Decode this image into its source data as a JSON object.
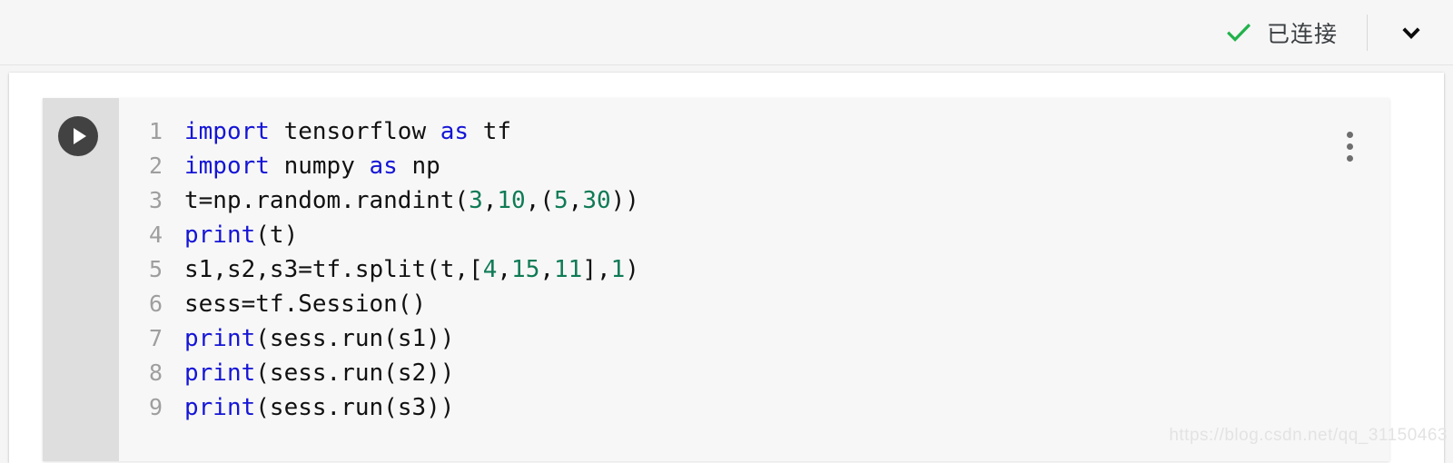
{
  "header": {
    "status_label": "已连接",
    "status_icon": "check-icon",
    "status_color": "#22b24c",
    "expand_icon": "chevron-down-icon"
  },
  "cell": {
    "run_icon": "play-icon",
    "menu_icon": "more-vert-icon",
    "language": "python",
    "line_count": 9,
    "lines": [
      {
        "number": "1",
        "tokens": [
          {
            "t": "import",
            "c": "kw"
          },
          {
            "t": " tensorflow ",
            "c": "pl"
          },
          {
            "t": "as",
            "c": "kw"
          },
          {
            "t": " tf",
            "c": "pl"
          }
        ],
        "text": "import tensorflow as tf"
      },
      {
        "number": "2",
        "tokens": [
          {
            "t": "import",
            "c": "kw"
          },
          {
            "t": " numpy ",
            "c": "pl"
          },
          {
            "t": "as",
            "c": "kw"
          },
          {
            "t": " np",
            "c": "pl"
          }
        ],
        "text": "import numpy as np"
      },
      {
        "number": "3",
        "tokens": [
          {
            "t": "t=np.random.randint(",
            "c": "pl"
          },
          {
            "t": "3",
            "c": "num"
          },
          {
            "t": ",",
            "c": "pl"
          },
          {
            "t": "10",
            "c": "num"
          },
          {
            "t": ",(",
            "c": "pl"
          },
          {
            "t": "5",
            "c": "num"
          },
          {
            "t": ",",
            "c": "pl"
          },
          {
            "t": "30",
            "c": "num"
          },
          {
            "t": "))",
            "c": "pl"
          }
        ],
        "text": "t=np.random.randint(3,10,(5,30))"
      },
      {
        "number": "4",
        "tokens": [
          {
            "t": "print",
            "c": "kw"
          },
          {
            "t": "(t)",
            "c": "pl"
          }
        ],
        "text": "print(t)"
      },
      {
        "number": "5",
        "tokens": [
          {
            "t": "s1,s2,s3=tf.split(t,[",
            "c": "pl"
          },
          {
            "t": "4",
            "c": "num"
          },
          {
            "t": ",",
            "c": "pl"
          },
          {
            "t": "15",
            "c": "num"
          },
          {
            "t": ",",
            "c": "pl"
          },
          {
            "t": "11",
            "c": "num"
          },
          {
            "t": "],",
            "c": "pl"
          },
          {
            "t": "1",
            "c": "num"
          },
          {
            "t": ")",
            "c": "pl"
          }
        ],
        "text": "s1,s2,s3=tf.split(t,[4,15,11],1)"
      },
      {
        "number": "6",
        "tokens": [
          {
            "t": "sess=tf.Session()",
            "c": "pl"
          }
        ],
        "text": "sess=tf.Session()"
      },
      {
        "number": "7",
        "tokens": [
          {
            "t": "print",
            "c": "kw"
          },
          {
            "t": "(sess.run(s1))",
            "c": "pl"
          }
        ],
        "text": "print(sess.run(s1))"
      },
      {
        "number": "8",
        "tokens": [
          {
            "t": "print",
            "c": "kw"
          },
          {
            "t": "(sess.run(s2))",
            "c": "pl"
          }
        ],
        "text": "print(sess.run(s2))"
      },
      {
        "number": "9",
        "tokens": [
          {
            "t": "print",
            "c": "kw"
          },
          {
            "t": "(sess.run(s3))",
            "c": "pl"
          }
        ],
        "text": "print(sess.run(s3))"
      }
    ]
  },
  "watermark": {
    "text": "https://blog.csdn.net/qq_31150463"
  },
  "colors": {
    "keyword": "#1515d6",
    "number": "#0f7b55",
    "plain": "#111111",
    "line_number": "#9e9e9e",
    "status_green": "#22b24c",
    "gutter": "#dedede",
    "cell_bg": "#f7f7f7"
  }
}
